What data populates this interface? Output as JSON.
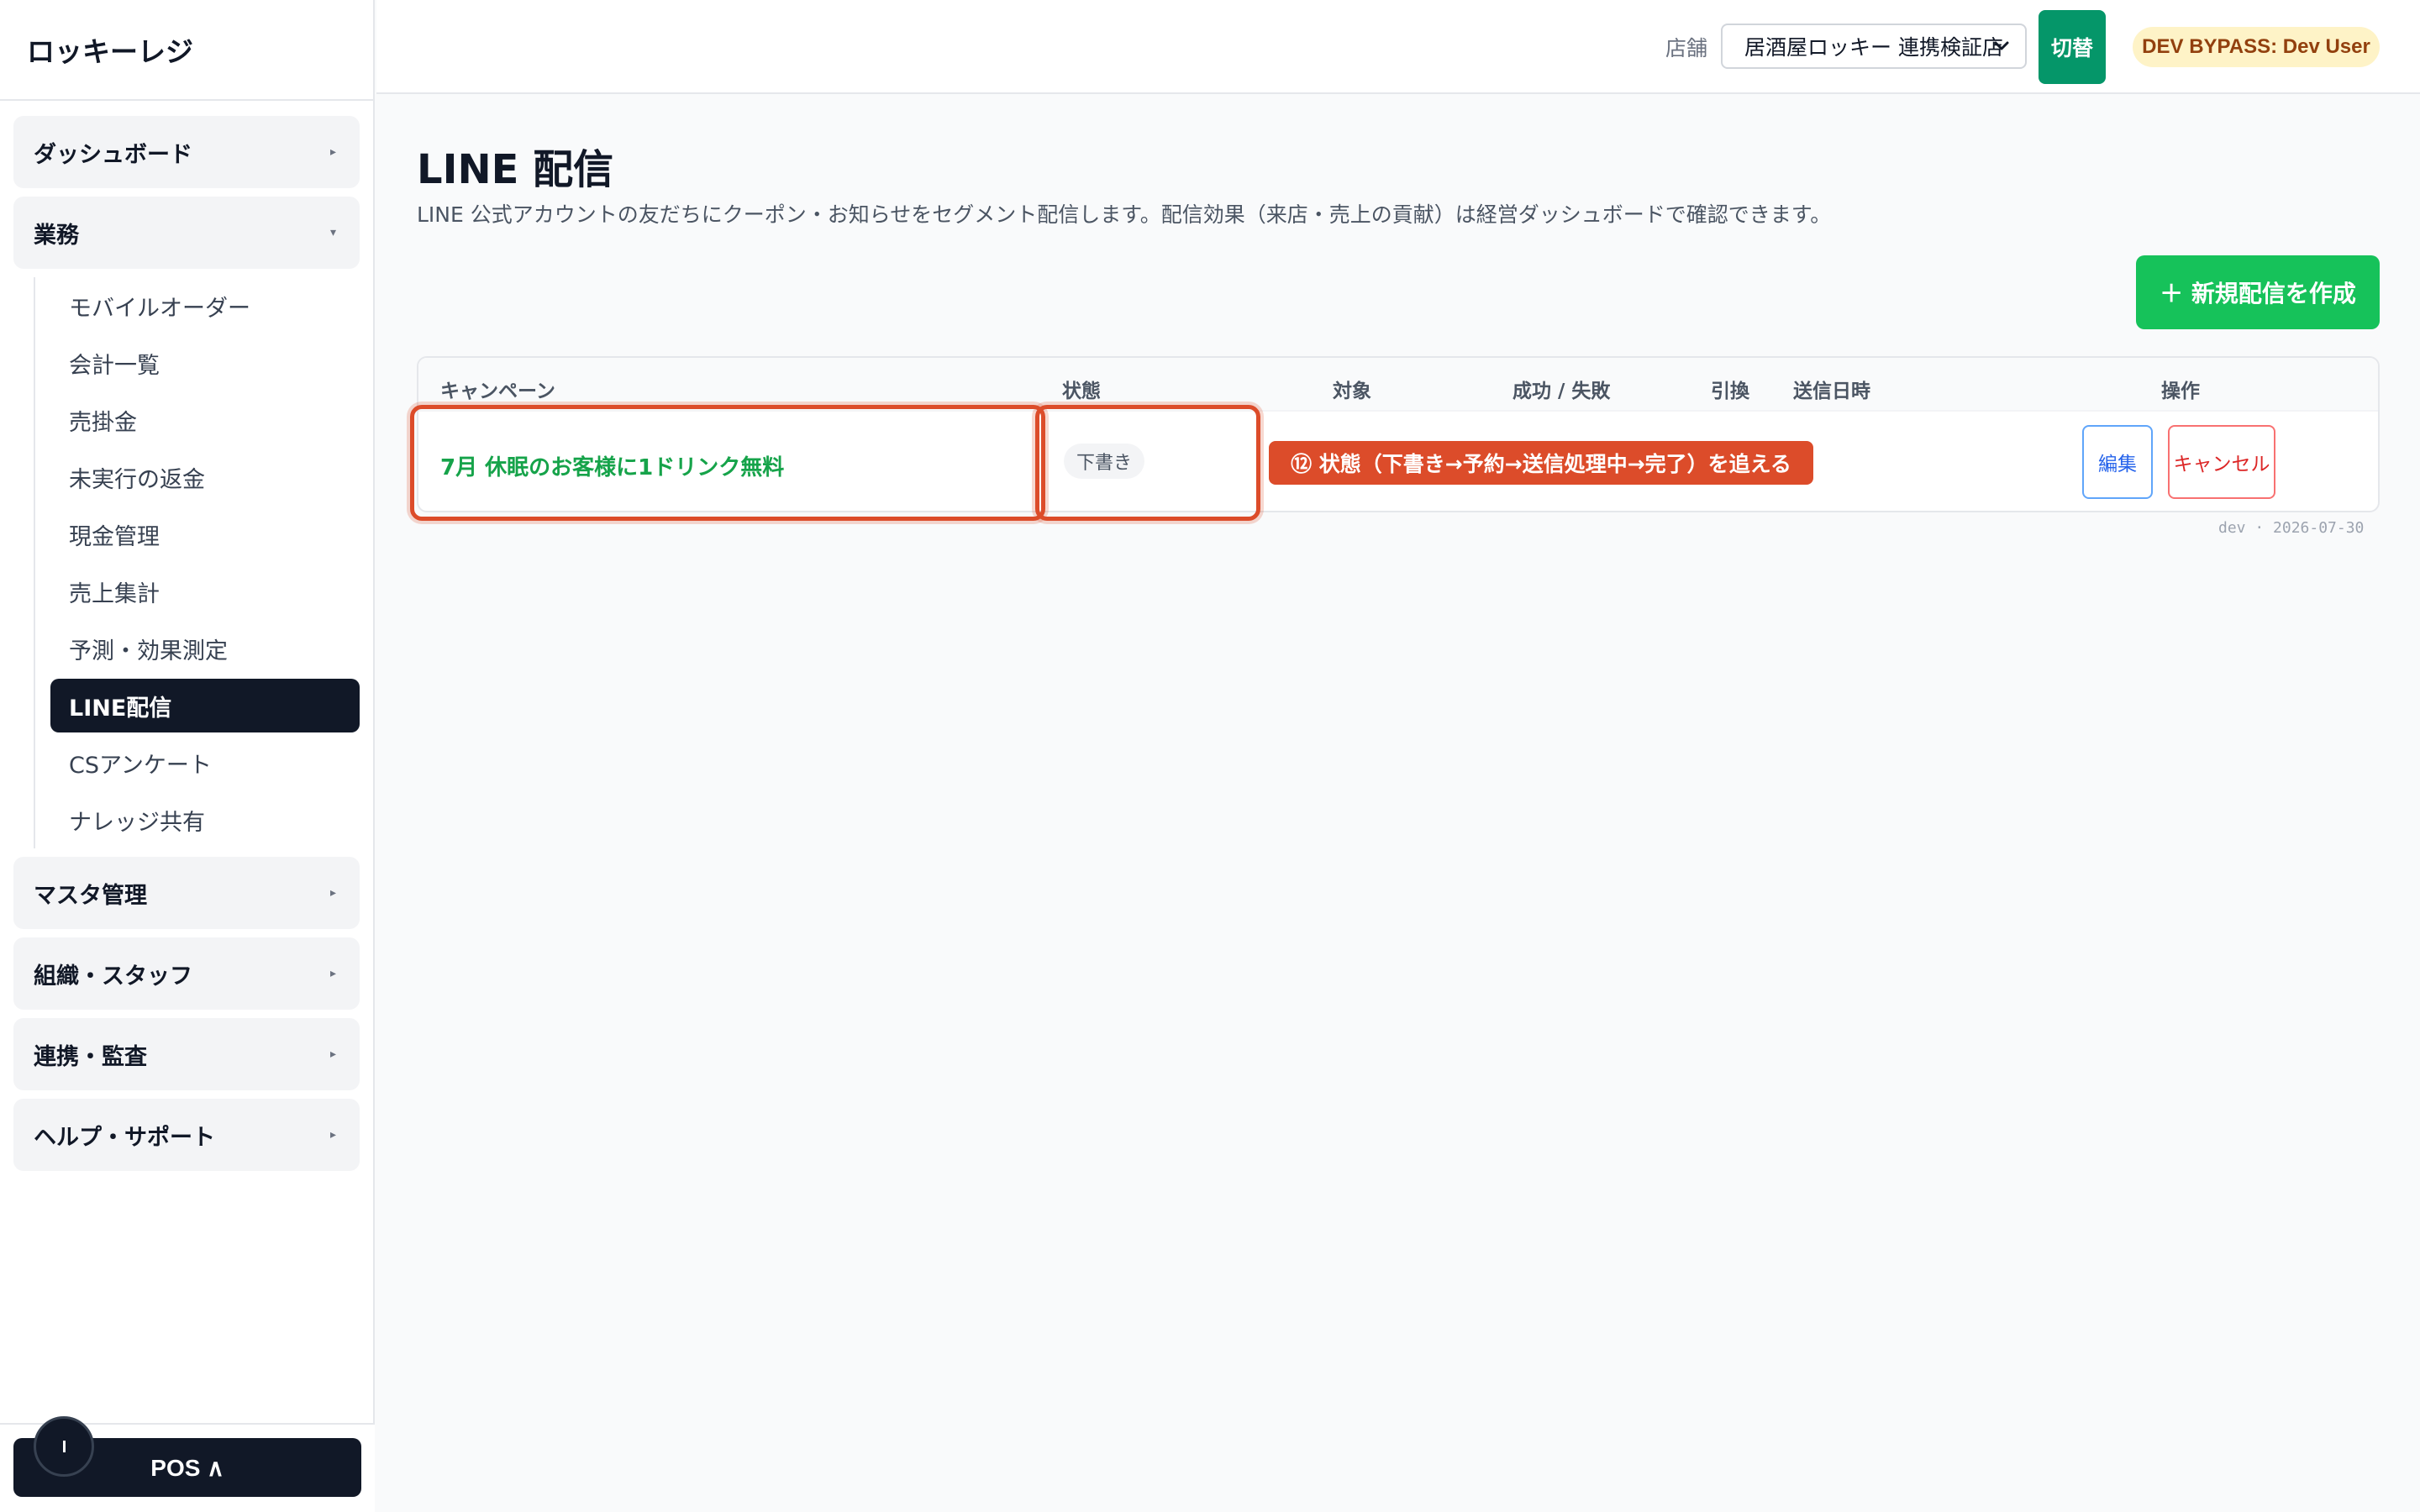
{
  "app": {
    "brand": "ロッキーレジ"
  },
  "sidebar": {
    "groups": [
      {
        "label": "ダッシュボード",
        "caret": "▸"
      },
      {
        "label": "業務",
        "caret": "▾"
      },
      {
        "label": "マスタ管理",
        "caret": "▸"
      },
      {
        "label": "組織・スタッフ",
        "caret": "▸"
      },
      {
        "label": "連携・監査",
        "caret": "▸"
      },
      {
        "label": "ヘルプ・サポート",
        "caret": "▸"
      }
    ],
    "business_items": [
      "モバイルオーダー",
      "会計一覧",
      "売掛金",
      "未実行の返金",
      "現金管理",
      "売上集計",
      "予測・効果測定",
      "LINE配信",
      "CSアンケート",
      "ナレッジ共有"
    ],
    "active_item": "LINE配信",
    "pos_button_label": "POS ∧"
  },
  "header": {
    "store_label": "店舗",
    "store_selected": "居酒屋ロッキー 連携検証店",
    "switch_label": "切替",
    "user_badge": "DEV BYPASS: Dev User"
  },
  "main": {
    "title": "LINE 配信",
    "description": "LINE 公式アカウントの友だちにクーポン・お知らせをセグメント配信します。配信効果（来店・売上の貢献）は経営ダッシュボードで確認できます。",
    "new_button_label": "＋ 新規配信を作成",
    "table": {
      "columns": [
        "キャンペーン",
        "状態",
        "対象",
        "成功 / 失敗",
        "引換",
        "送信日時",
        "操作"
      ],
      "rows": [
        {
          "campaign": "7月 休眠のお客様に1ドリンク無料",
          "status": "下書き",
          "target": "",
          "success_fail": "",
          "redeemed": "",
          "sent_at": "",
          "actions": [
            "編集",
            "キャンセル"
          ]
        }
      ]
    },
    "annotation": "⑫ 状態（下書き→予約→送信処理中→完了）を追える",
    "build_info": "dev · 2026-07-30"
  },
  "colors": {
    "accent_green": "#16c25a",
    "campaign_link": "#16a34a",
    "highlight_red": "#dc4c2a",
    "sidebar_active": "#111827",
    "switch_button": "#059669",
    "dev_badge_bg": "#fef3c7"
  },
  "icons": {
    "select_chevron": "chevron-down-icon",
    "group_caret": "caret-icon"
  }
}
